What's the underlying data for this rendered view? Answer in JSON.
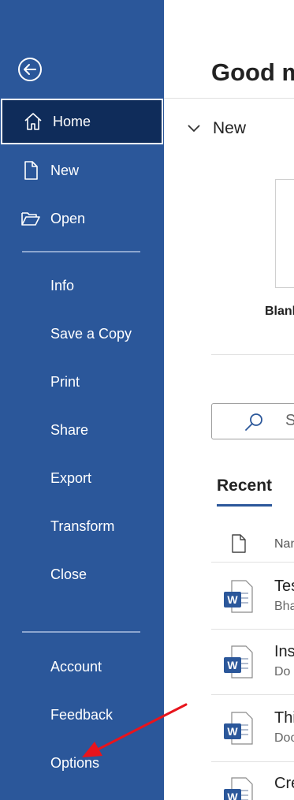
{
  "sidebar": {
    "top_items": [
      {
        "label": "Home",
        "icon": "home-icon"
      },
      {
        "label": "New",
        "icon": "new-document-icon"
      },
      {
        "label": "Open",
        "icon": "folder-open-icon"
      }
    ],
    "middle_items": [
      "Info",
      "Save a Copy",
      "Print",
      "Share",
      "Export",
      "Transform",
      "Close"
    ],
    "bottom_items": [
      "Account",
      "Feedback",
      "Options"
    ]
  },
  "main": {
    "greeting": "Good m",
    "new_section": "New",
    "blank_label": "Blanl",
    "search_placeholder": "S",
    "recent_tab": "Recent",
    "column_name": "Nan",
    "files": [
      {
        "title": "Tes",
        "subtitle": "Bha"
      },
      {
        "title": "Ins",
        "subtitle": "Do"
      },
      {
        "title": "Thi",
        "subtitle": "Doo"
      },
      {
        "title": "Cre",
        "subtitle": ""
      }
    ]
  },
  "colors": {
    "accent": "#2b579a",
    "selected": "#0f2c5a",
    "annotation_arrow": "#e8141c"
  }
}
